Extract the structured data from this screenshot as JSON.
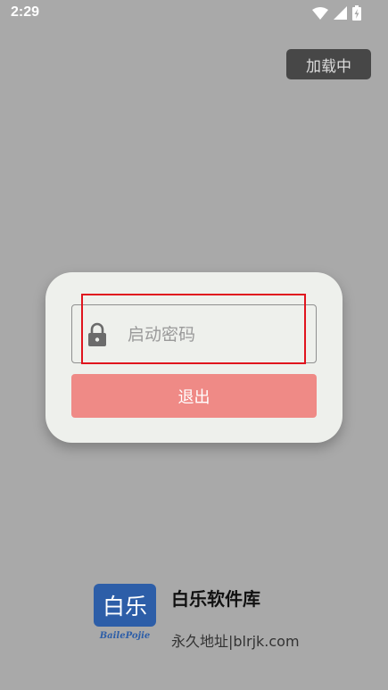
{
  "status_bar": {
    "time": "2:29",
    "icons": [
      "wifi-icon",
      "signal-icon",
      "battery-charging-icon"
    ]
  },
  "loading_badge": {
    "label": "加载中"
  },
  "dialog": {
    "password_field": {
      "placeholder": "启动密码",
      "value": ""
    },
    "exit_button": {
      "label": "退出"
    }
  },
  "brand": {
    "logo_text": "白乐",
    "logo_subtext": "BailePojie",
    "name": "白乐软件库",
    "url": "永久地址|blrjk.com"
  },
  "colors": {
    "background": "#a9a9a9",
    "dialog": "#eef0ec",
    "exit_button": "#ef8a86",
    "highlight": "#e0141e",
    "logo_blue": "#2d5ea8"
  }
}
